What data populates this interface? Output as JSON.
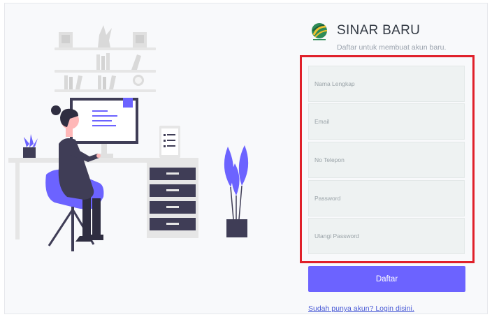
{
  "brand": {
    "logo_icon": "globe-logo-icon",
    "title": "SINAR BARU",
    "subtitle": "Daftar untuk membuat akun baru."
  },
  "form": {
    "fields": [
      {
        "placeholder": "Nama Lengkap",
        "value": ""
      },
      {
        "placeholder": "Email",
        "value": ""
      },
      {
        "placeholder": "No Telepon",
        "value": ""
      },
      {
        "placeholder": "Password",
        "value": ""
      },
      {
        "placeholder": "Ulangi Password",
        "value": ""
      }
    ],
    "submit_label": "Daftar",
    "login_link": "Sudah punya akun? Login disini."
  },
  "colors": {
    "accent": "#6c63ff",
    "highlight_border": "#e0202a",
    "field_bg": "#eef2f2",
    "link": "#4a5bd6",
    "illustration_dark": "#2f2e41"
  },
  "illustration": {
    "name": "person-working-at-desk-illustration"
  }
}
